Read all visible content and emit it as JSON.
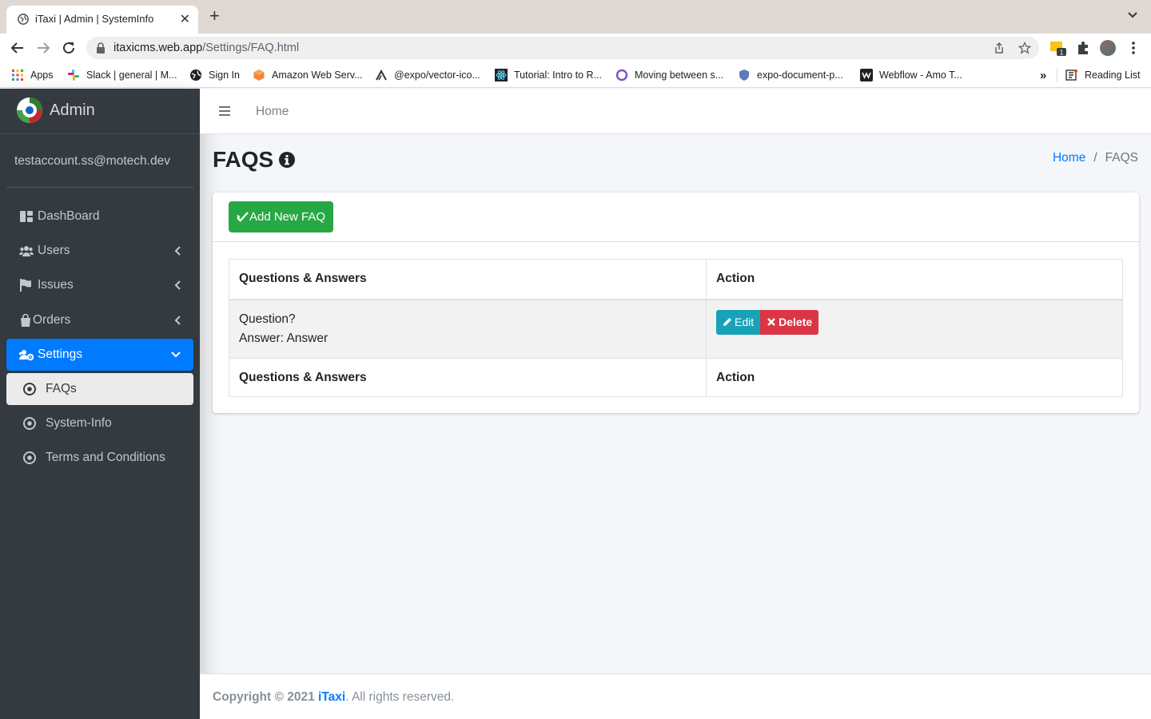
{
  "browser": {
    "tab_title": "iTaxi | Admin | SystemInfo",
    "url_host": "itaxicms.web.app",
    "url_path": "/Settings/FAQ.html",
    "bookmarks": [
      {
        "label": "Apps",
        "icon": "apps-grid-icon"
      },
      {
        "label": "Slack | general | M...",
        "icon": "slack-icon"
      },
      {
        "label": "Sign In",
        "icon": "globe-icon"
      },
      {
        "label": "Amazon Web Serv...",
        "icon": "aws-icon"
      },
      {
        "label": "@expo/vector-ico...",
        "icon": "expo-icon"
      },
      {
        "label": "Tutorial: Intro to R...",
        "icon": "react-icon"
      },
      {
        "label": "Moving between s...",
        "icon": "circle-icon"
      },
      {
        "label": "expo-document-p...",
        "icon": "shield-icon"
      },
      {
        "label": "Webflow - Amo T...",
        "icon": "webflow-icon"
      }
    ],
    "more_bookmarks": "»",
    "reading_list": "Reading List",
    "extension_badge": "1"
  },
  "sidebar": {
    "brand": "Admin",
    "user_email": "testaccount.ss@motech.dev",
    "items": [
      {
        "label": "DashBoard",
        "icon": "dashboard-icon"
      },
      {
        "label": "Users",
        "icon": "users-icon"
      },
      {
        "label": "Issues",
        "icon": "flag-icon"
      },
      {
        "label": "Orders",
        "icon": "shopping-bag-icon"
      },
      {
        "label": "Settings",
        "icon": "users-cog-icon"
      }
    ],
    "sub_items": [
      {
        "label": "FAQs"
      },
      {
        "label": "System-Info"
      },
      {
        "label": "Terms and Conditions"
      }
    ]
  },
  "topbar": {
    "home_link": "Home"
  },
  "page": {
    "title": "FAQS",
    "breadcrumb_home": "Home",
    "breadcrumb_sep": "/",
    "breadcrumb_current": "FAQS"
  },
  "card": {
    "add_button": "Add New FAQ",
    "table": {
      "headers": [
        "Questions & Answers",
        "Action"
      ],
      "rows": [
        {
          "question": "Question?",
          "answer": "Answer: Answer"
        }
      ],
      "footers": [
        "Questions & Answers",
        "Action"
      ],
      "edit_label": "Edit",
      "delete_label": "Delete"
    }
  },
  "footer": {
    "prefix": "Copyright © 2021 ",
    "brand": "iTaxi",
    "suffix": ". All rights reserved."
  },
  "colors": {
    "sidebar_bg": "#343a40",
    "primary": "#007bff",
    "success": "#28a745",
    "info": "#17a2b8",
    "danger": "#dc3545"
  }
}
